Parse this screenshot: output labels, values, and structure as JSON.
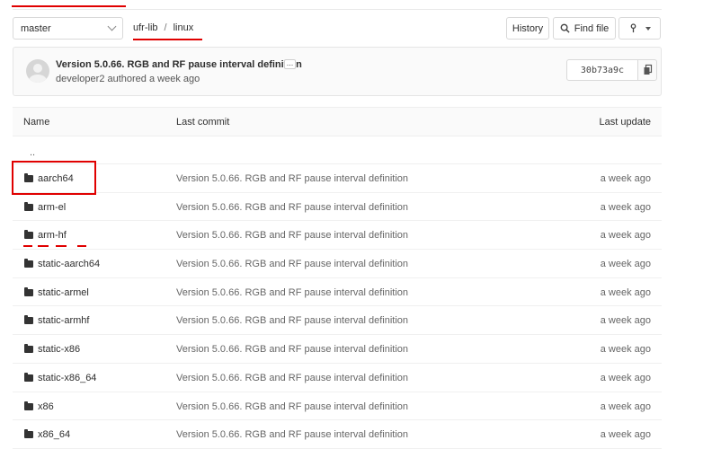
{
  "branch": {
    "selected": "master"
  },
  "breadcrumb": {
    "root": "ufr-lib",
    "separator": "/",
    "current": "linux"
  },
  "toolbar": {
    "history_label": "History",
    "find_file_label": "Find file",
    "clone_icon": "git-fork-icon"
  },
  "last_commit": {
    "title": "Version 5.0.66. RGB and RF pause interval definition",
    "ellipsis": "...",
    "meta": "developer2 authored a week ago",
    "sha": "30b73a9c"
  },
  "table": {
    "headers": {
      "name": "Name",
      "last_commit": "Last commit",
      "last_update": "Last update"
    },
    "parent_link": "..",
    "rows": [
      {
        "name": "aarch64",
        "commit": "Version 5.0.66. RGB and RF pause interval definition",
        "updated": "a week ago"
      },
      {
        "name": "arm-el",
        "commit": "Version 5.0.66. RGB and RF pause interval definition",
        "updated": "a week ago"
      },
      {
        "name": "arm-hf",
        "commit": "Version 5.0.66. RGB and RF pause interval definition",
        "updated": "a week ago"
      },
      {
        "name": "static-aarch64",
        "commit": "Version 5.0.66. RGB and RF pause interval definition",
        "updated": "a week ago"
      },
      {
        "name": "static-armel",
        "commit": "Version 5.0.66. RGB and RF pause interval definition",
        "updated": "a week ago"
      },
      {
        "name": "static-armhf",
        "commit": "Version 5.0.66. RGB and RF pause interval definition",
        "updated": "a week ago"
      },
      {
        "name": "static-x86",
        "commit": "Version 5.0.66. RGB and RF pause interval definition",
        "updated": "a week ago"
      },
      {
        "name": "static-x86_64",
        "commit": "Version 5.0.66. RGB and RF pause interval definition",
        "updated": "a week ago"
      },
      {
        "name": "x86",
        "commit": "Version 5.0.66. RGB and RF pause interval definition",
        "updated": "a week ago"
      },
      {
        "name": "x86_64",
        "commit": "Version 5.0.66. RGB and RF pause interval definition",
        "updated": "a week ago"
      }
    ]
  },
  "colors": {
    "annotation": "#e00000",
    "border": "#d9d9d9",
    "header_bg": "#fafafa"
  }
}
